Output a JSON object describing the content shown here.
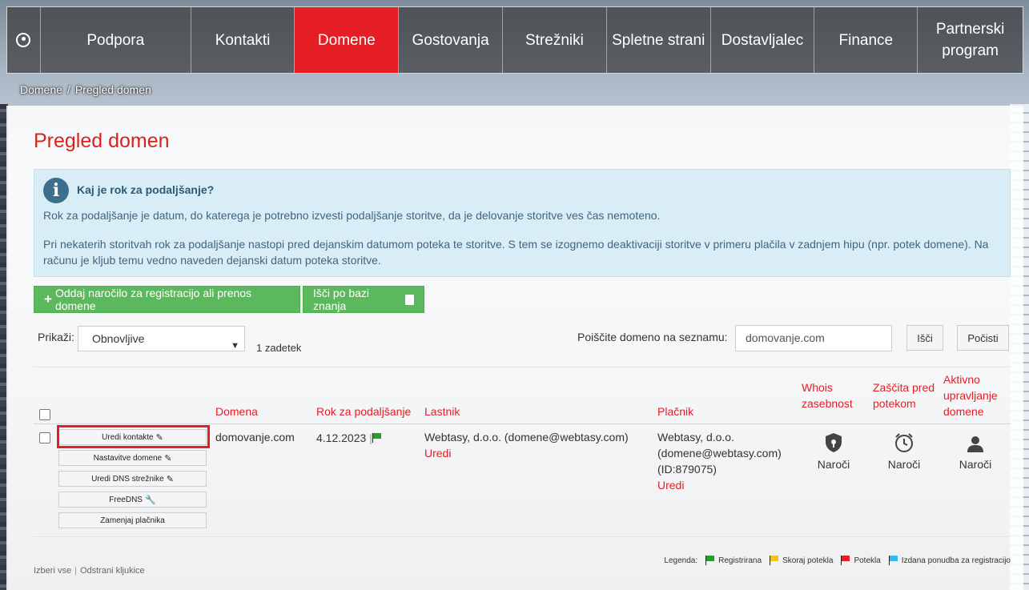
{
  "nav": {
    "items": [
      {
        "label": "Podpora"
      },
      {
        "label": "Kontakti"
      },
      {
        "label": "Domene",
        "active": true
      },
      {
        "label": "Gostovanja"
      },
      {
        "label": "Strežniki"
      },
      {
        "label": "Spletne strani"
      },
      {
        "label": "Dostavljalec"
      },
      {
        "label": "Finance"
      },
      {
        "label": "Partnerski program"
      }
    ]
  },
  "breadcrumb": {
    "root": "Domene",
    "separator": "/",
    "current": "Pregled domen"
  },
  "page": {
    "title": "Pregled domen"
  },
  "info": {
    "title": "Kaj je rok za podaljšanje?",
    "p1": "Rok za podaljšanje je datum, do katerega je potrebno izvesti podaljšanje storitve, da je delovanje storitve ves čas nemoteno.",
    "p2": "Pri nekaterih storitvah rok za podaljšanje nastopi pred dejanskim datumom poteka te storitve. S tem se izognemo deaktivaciji storitve v primeru plačila v zadnjem hipu (npr. potek domene). Na računu je kljub temu vedno naveden dejanski datum poteka storitve."
  },
  "actions": {
    "order_label": "Oddaj naročilo za registracijo ali prenos domene",
    "kb_label": "Išči po bazi znanja"
  },
  "filter": {
    "show_label": "Prikaži:",
    "show_value": "Obnovljive",
    "count": "1 zadetek",
    "search_label": "Poiščite domeno na seznamu:",
    "search_value": "domovanje.com",
    "search_button": "Išči",
    "clear_button": "Počisti"
  },
  "table": {
    "headers": {
      "domain": "Domena",
      "renewal": "Rok za podaljšanje",
      "owner": "Lastnik",
      "payer": "Plačnik",
      "whois": "Whois zasebnost",
      "protection": "Zaščita pred potekom",
      "managed": "Aktivno upravljanje domene"
    },
    "row": {
      "buttons": [
        "Uredi kontakte",
        "Nastavitve domene",
        "Uredi DNS strežnike",
        "FreeDNS",
        "Zamenjaj plačnika"
      ],
      "domain": "domovanje.com",
      "renewal": "4.12.2023",
      "owner": "Webtasy, d.o.o. (domene@webtasy.com)",
      "owner_edit": "Uredi",
      "payer_line1": "Webtasy, d.o.o.",
      "payer_line2": "(domene@webtasy.com)",
      "payer_line3": "(ID:879075)",
      "payer_edit": "Uredi",
      "whois_action": "Naroči",
      "protection_action": "Naroči",
      "managed_action": "Naroči"
    }
  },
  "footer": {
    "select_all": "Izberi vse",
    "separator": "|",
    "clear_checks": "Odstrani kljukice",
    "legend_label": "Legenda:",
    "legend": [
      {
        "label": "Registrirana",
        "color": "#2a9c2a"
      },
      {
        "label": "Skoraj potekla",
        "color": "#f0c419"
      },
      {
        "label": "Potekla",
        "color": "#e51e25"
      },
      {
        "label": "Izdana ponudba za registracijo",
        "color": "#3ab6e8"
      }
    ]
  },
  "colors": {
    "accent": "#e51e25",
    "success": "#5cb85c",
    "info_bg": "#d9edf7"
  }
}
